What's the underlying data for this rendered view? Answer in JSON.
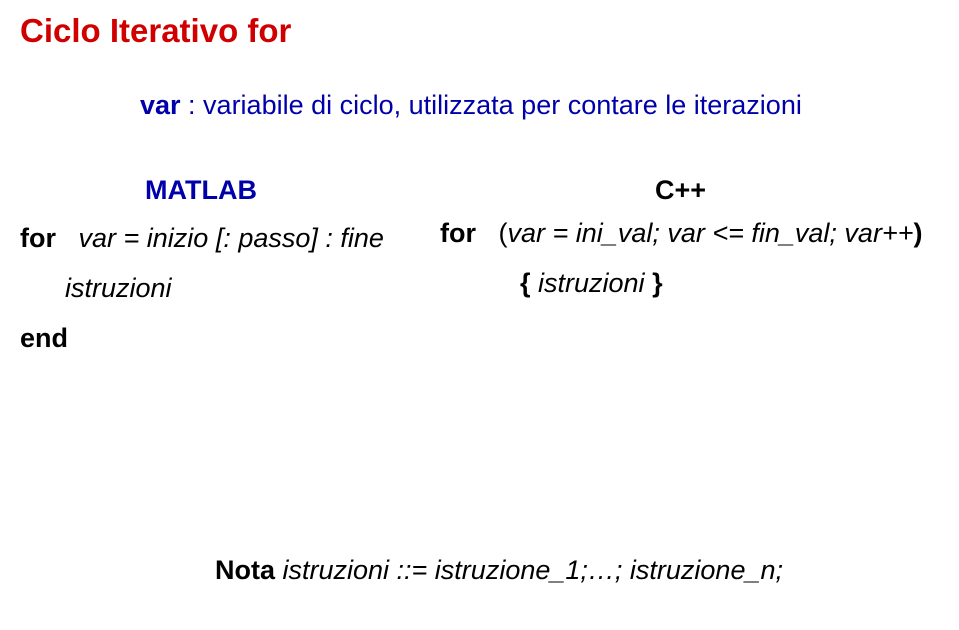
{
  "title": "Ciclo Iterativo for",
  "subtitle": {
    "var": "var",
    "rest": " : variabile di ciclo, utilizzata per contare le iterazioni"
  },
  "matlab": {
    "label": "MATLAB",
    "line1_kw": "for",
    "line1_rest": "var = inizio [: passo] : fine",
    "line2": "istruzioni",
    "line3": "end"
  },
  "cpp": {
    "label": "C++",
    "line1_kw": "for",
    "line1_open": "(",
    "line1_body": "var = ini_val; var <= fin_val; var++",
    "line1_close": ")",
    "line2_open": "{",
    "line2_body": " istruzioni ",
    "line2_close": "}"
  },
  "note": {
    "bold": "Nota",
    "rest": " istruzioni ::= istruzione_1;…; istruzione_n;"
  }
}
